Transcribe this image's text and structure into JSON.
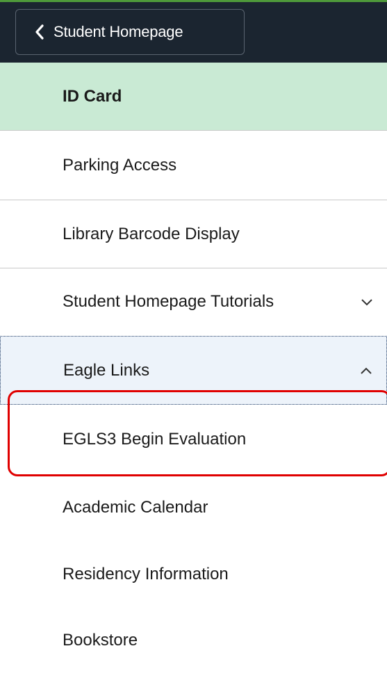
{
  "header": {
    "back_button_label": "Student Homepage"
  },
  "menu": {
    "items": [
      {
        "label": "ID Card"
      },
      {
        "label": "Parking Access"
      },
      {
        "label": "Library Barcode Display"
      },
      {
        "label": "Student Homepage Tutorials"
      },
      {
        "label": "Eagle Links"
      },
      {
        "label": "EGLS3 Begin Evaluation"
      },
      {
        "label": "Academic Calendar"
      },
      {
        "label": "Residency Information"
      },
      {
        "label": "Bookstore"
      }
    ]
  },
  "colors": {
    "header_bg": "#1b2530",
    "active_bg": "#c9ead4",
    "expanded_bg": "#edf3fa",
    "highlight_border": "#e00000"
  },
  "icons": [
    "chevron-left-icon",
    "chevron-down-icon",
    "chevron-up-icon"
  ]
}
